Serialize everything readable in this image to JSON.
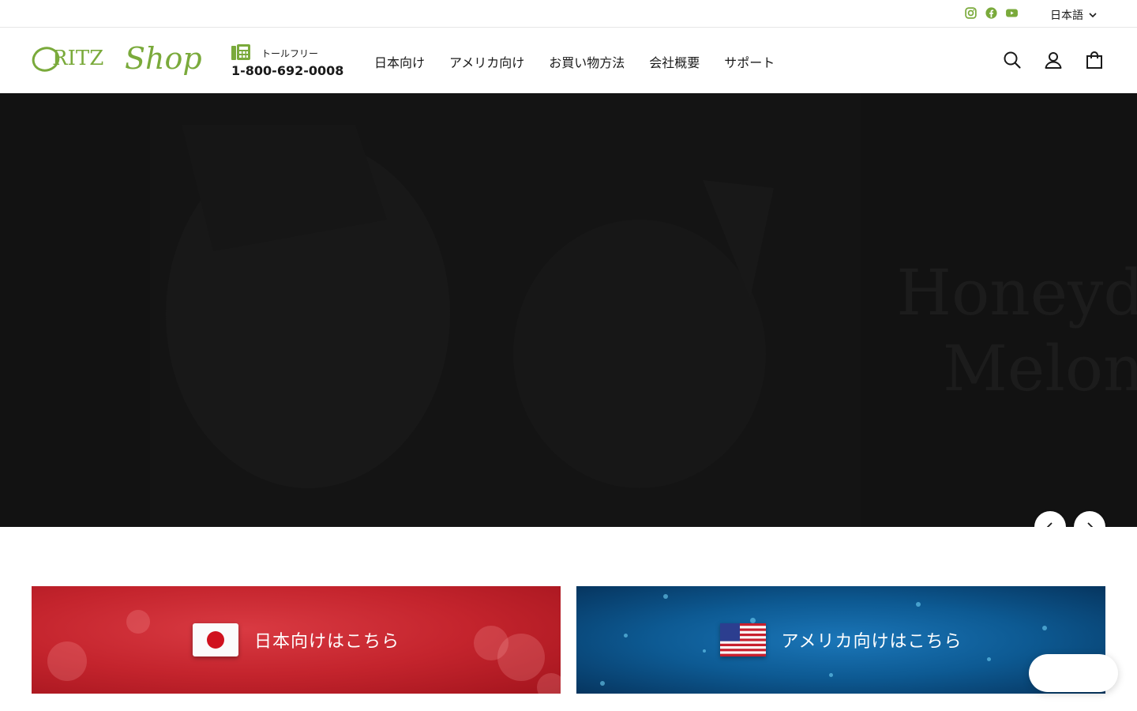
{
  "utility": {
    "social": [
      "instagram-icon",
      "facebook-icon",
      "youtube-icon"
    ],
    "language": "日本語"
  },
  "header": {
    "logo_text_main": "RITZ",
    "logo_text_script": "Shop",
    "phone_label": "トールフリー",
    "phone_number": "1-800-692-0008",
    "nav": [
      "日本向け",
      "アメリカ向け",
      "お買い物方法",
      "会社概要",
      "サポート"
    ],
    "icons": [
      "search-icon",
      "account-icon",
      "cart-icon"
    ]
  },
  "hero": {
    "title_line1": "Honeyd",
    "title_line2": "Melon"
  },
  "banners": {
    "japan_label": "日本向けはこちら",
    "usa_label": "アメリカ向けはこちら"
  },
  "colors": {
    "brand_green": "#7aaa3b",
    "hero_bg": "#121212",
    "japan_red": "#c4242d",
    "usa_blue": "#0d5a93"
  }
}
